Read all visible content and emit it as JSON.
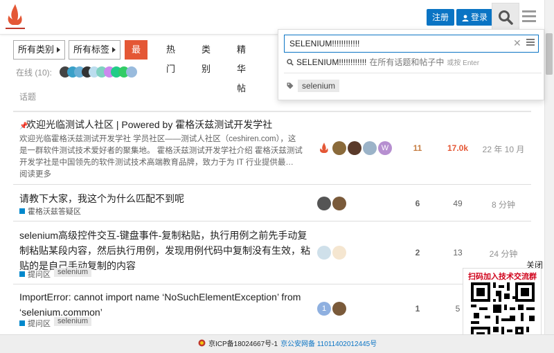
{
  "header": {
    "register": "注册",
    "login": "登录"
  },
  "filters": {
    "all_categories": "所有类别",
    "all_tags": "所有标签",
    "nav": [
      "最新",
      "热门",
      "类别",
      "精华帖"
    ]
  },
  "online": "在线 (10):",
  "column_header": "话题",
  "topics": [
    {
      "title": "欢迎光临测试人社区 | Powered by 霍格沃兹测试开发学社",
      "excerpt": "欢迎光临霍格沃兹测试开发学社 学员社区——测试人社区（ceshiren.com），这是一群软件测试技术爱好者的聚集地。 霍格沃兹测试开发学社介绍 霍格沃兹测试开发学社是中国领先的软件测试技术高端教育品牌，致力于为 IT 行业提供最…",
      "more": "阅读更多",
      "replies": "11",
      "views": "17.0k",
      "activity": "22 年 10 月"
    },
    {
      "title": "请教下大家，我这个为什么匹配不到呢",
      "category": "霍格沃兹答疑区",
      "replies": "6",
      "views": "49",
      "activity": "8 分钟"
    },
    {
      "title": "selenium高级控件交互-键盘事件-复制粘贴，执行用例之前先手动复制粘贴某段内容，然后执行用例，发现用例代码中复制没有生效，粘贴的是自己手动复制的内容",
      "category": "提问区",
      "tag": "selenium",
      "replies": "2",
      "views": "13",
      "activity": "24 分钟"
    },
    {
      "title": "ImportError: cannot import name ‘NoSuchElementException’ from ‘selenium.common’",
      "category": "提问区",
      "tag": "selenium",
      "replies": "1",
      "views": "5",
      "avatar_letter": "1"
    }
  ],
  "search": {
    "value": "SELENIUM!!!!!!!!!!!!",
    "suggest_term": "SELENIUM!!!!!!!!!!!!",
    "suggest_scope": "在所有话题和帖子中",
    "suggest_hint": "或按 Enter",
    "tag": "selenium"
  },
  "qr": {
    "close": "关闭",
    "title": "扫码加入技术交流群"
  },
  "footer": {
    "icp": "京ICP备18024667号-1",
    "police": "京公安网备 11011402012445号"
  },
  "colors": {
    "primary": "#0a74c4",
    "accent": "#e45735",
    "category": "#0088cc"
  }
}
